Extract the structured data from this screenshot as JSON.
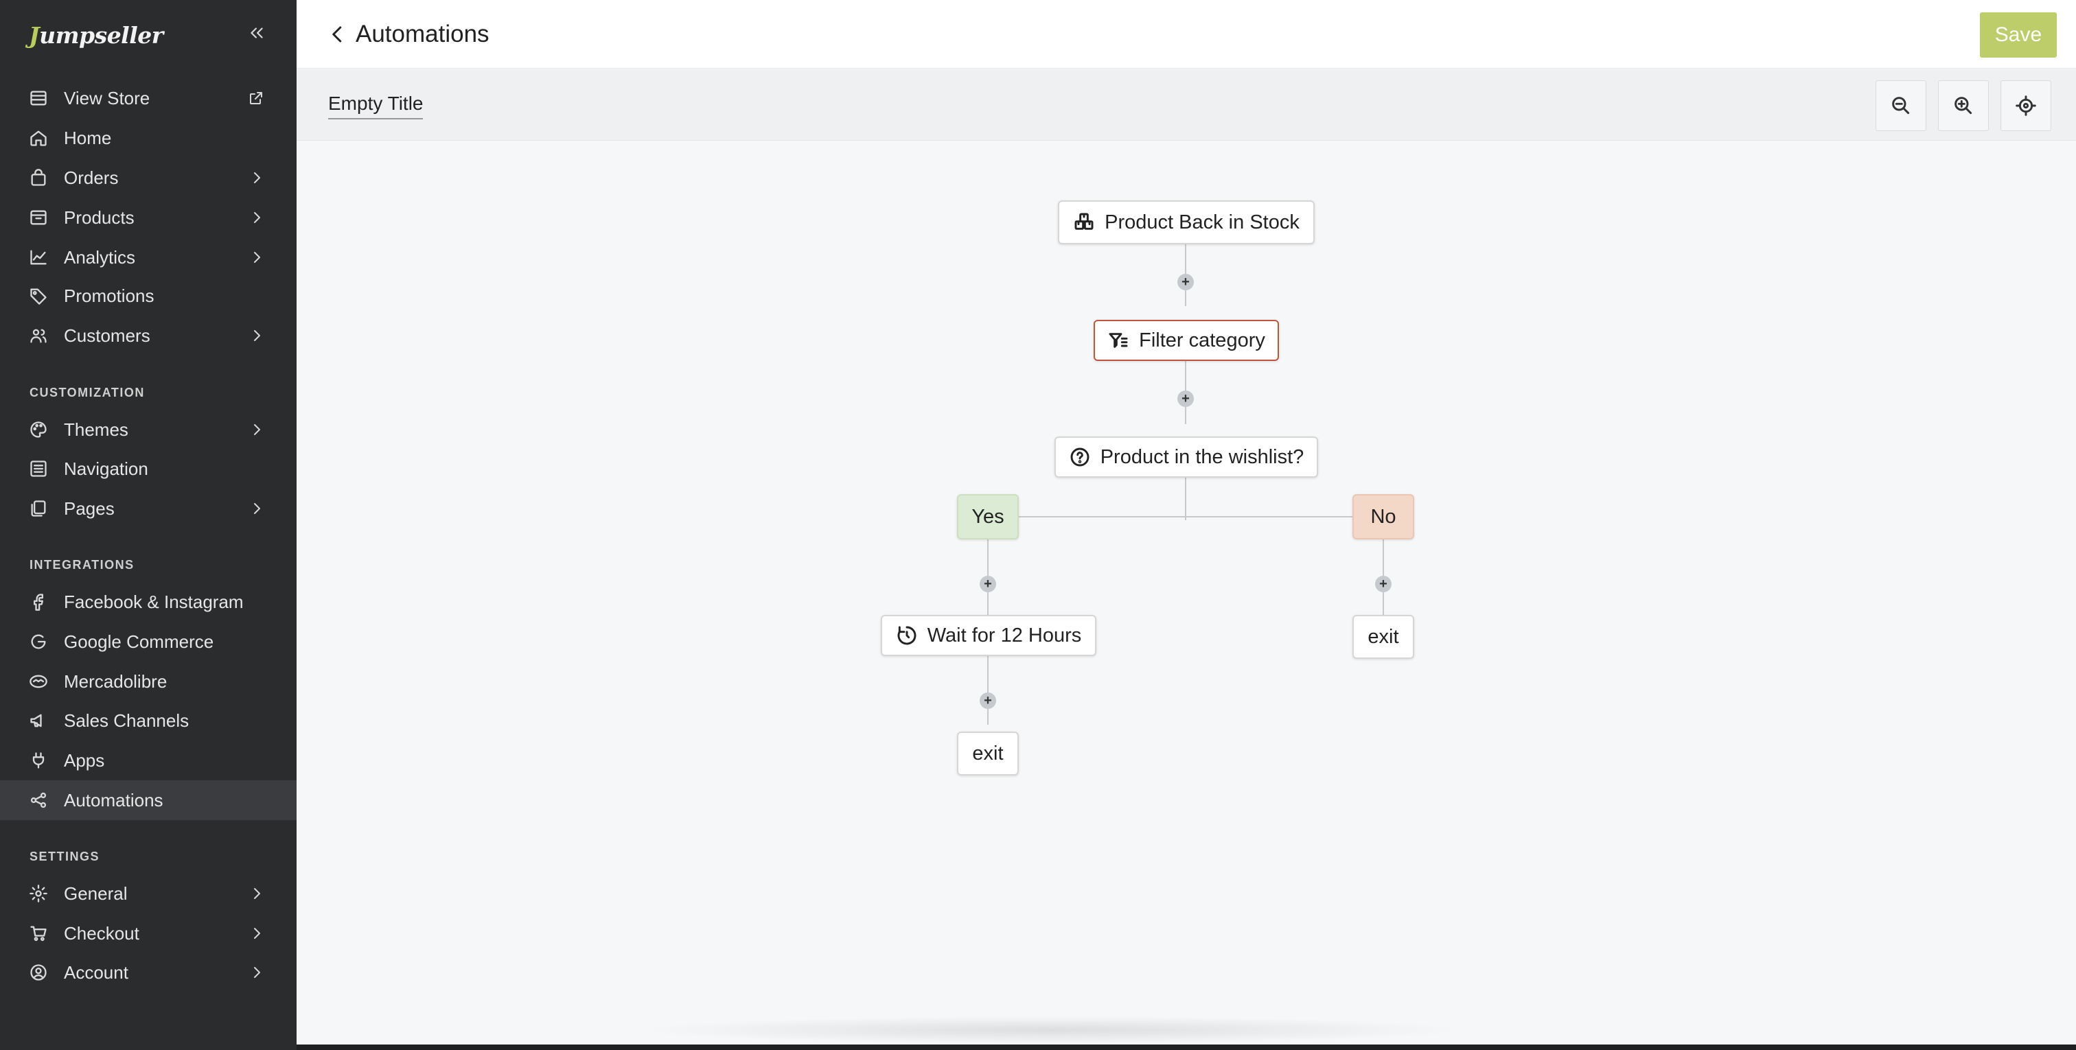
{
  "brand": {
    "logo_text": "umpseller",
    "logo_initial": "J"
  },
  "sidebar": {
    "items": [
      {
        "label": "View Store",
        "icon": "store-icon",
        "external": true
      },
      {
        "label": "Home",
        "icon": "home-icon"
      },
      {
        "label": "Orders",
        "icon": "bag-icon",
        "expandable": true
      },
      {
        "label": "Products",
        "icon": "box-icon",
        "expandable": true
      },
      {
        "label": "Analytics",
        "icon": "chart-icon",
        "expandable": true
      },
      {
        "label": "Promotions",
        "icon": "tag-icon"
      },
      {
        "label": "Customers",
        "icon": "users-icon",
        "expandable": true
      }
    ],
    "customization_title": "CUSTOMIZATION",
    "customization": [
      {
        "label": "Themes",
        "icon": "palette-icon",
        "expandable": true
      },
      {
        "label": "Navigation",
        "icon": "list-icon"
      },
      {
        "label": "Pages",
        "icon": "pages-icon",
        "expandable": true
      }
    ],
    "integrations_title": "INTEGRATIONS",
    "integrations": [
      {
        "label": "Facebook & Instagram",
        "icon": "facebook-icon"
      },
      {
        "label": "Google Commerce",
        "icon": "google-icon"
      },
      {
        "label": "Mercadolibre",
        "icon": "handshake-icon"
      },
      {
        "label": "Sales Channels",
        "icon": "megaphone-icon"
      },
      {
        "label": "Apps",
        "icon": "plug-icon"
      },
      {
        "label": "Automations",
        "icon": "share-icon",
        "active": true
      }
    ],
    "settings_title": "SETTINGS",
    "settings": [
      {
        "label": "General",
        "icon": "gear-icon",
        "expandable": true
      },
      {
        "label": "Checkout",
        "icon": "cart-icon",
        "expandable": true
      },
      {
        "label": "Account",
        "icon": "account-icon",
        "expandable": true
      }
    ]
  },
  "header": {
    "title": "Automations",
    "save_label": "Save"
  },
  "toolbar": {
    "flow_title": "Empty Title"
  },
  "flow": {
    "trigger": "Product Back in Stock",
    "filter": "Filter category",
    "condition": "Product in the wishlist?",
    "yes_label": "Yes",
    "no_label": "No",
    "wait": "Wait for 12 Hours",
    "exit_yes": "exit",
    "exit_no": "exit",
    "plus": "+"
  },
  "colors": {
    "accent": "#bccd6a",
    "sidebar_bg": "#2b2c2e",
    "yes_bg": "#dcebd3",
    "no_bg": "#f3d7c7",
    "filter_border": "#c0553f"
  }
}
